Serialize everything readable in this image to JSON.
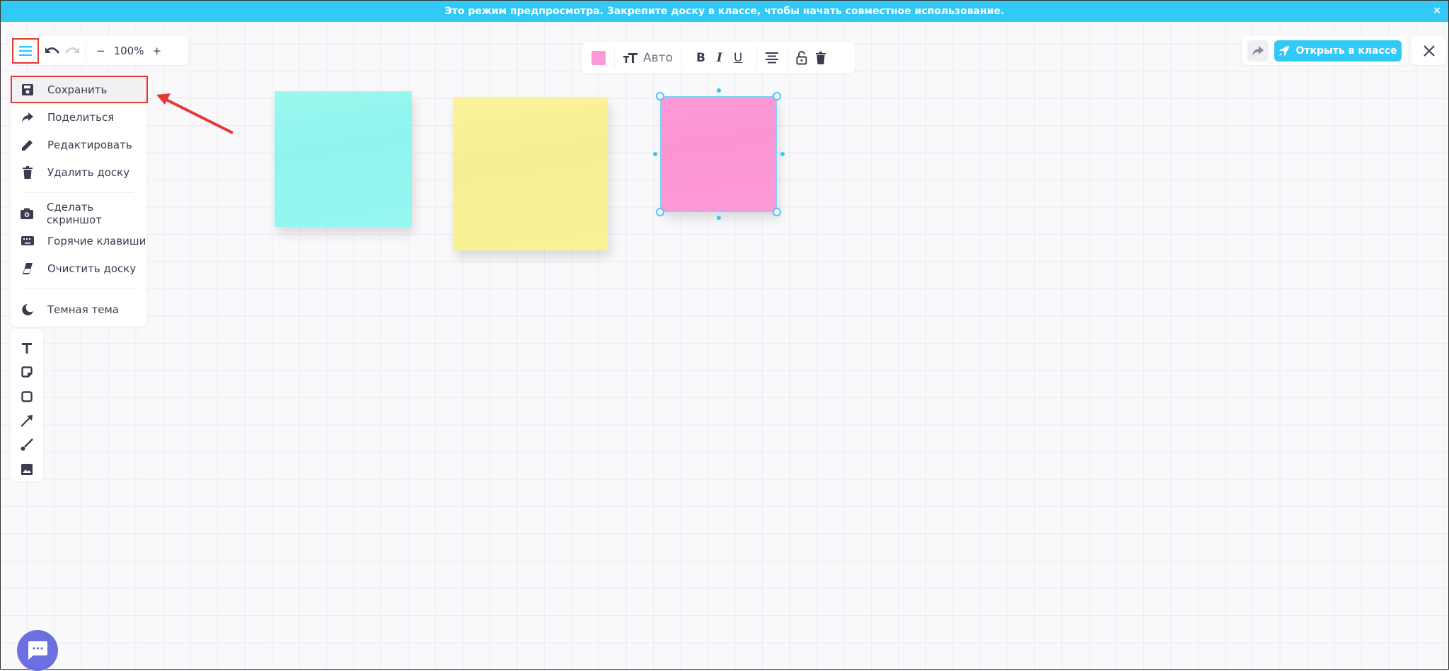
{
  "banner": {
    "text": "Это режим предпросмотра. Закрепите доску в классе, чтобы начать совместное использование.",
    "close": "×"
  },
  "top_left": {
    "zoom": "100%",
    "zoom_out": "−",
    "zoom_in": "+"
  },
  "menu": {
    "items": [
      {
        "label": "Сохранить",
        "icon": "save-icon"
      },
      {
        "label": "Поделиться",
        "icon": "share-icon"
      },
      {
        "label": "Редактировать",
        "icon": "pencil-icon"
      },
      {
        "label": "Удалить доску",
        "icon": "trash-icon"
      },
      {
        "label": "Сделать скриншот",
        "icon": "camera-icon"
      },
      {
        "label": "Горячие клавиши",
        "icon": "keyboard-icon"
      },
      {
        "label": "Очистить доску",
        "icon": "eraser-icon"
      },
      {
        "label": "Темная тема",
        "icon": "moon-icon"
      }
    ]
  },
  "text_toolbar": {
    "color": "#ff99d6",
    "size": "Авто"
  },
  "top_right": {
    "open_label": "Открыть в классе"
  },
  "notes": [
    {
      "color": "#95f7ee"
    },
    {
      "color": "#fbf295"
    },
    {
      "color": "#ff99d6"
    }
  ],
  "colors": {
    "accent": "#33c9f6",
    "highlight": "#e53935",
    "chat": "#6c6fe0"
  }
}
